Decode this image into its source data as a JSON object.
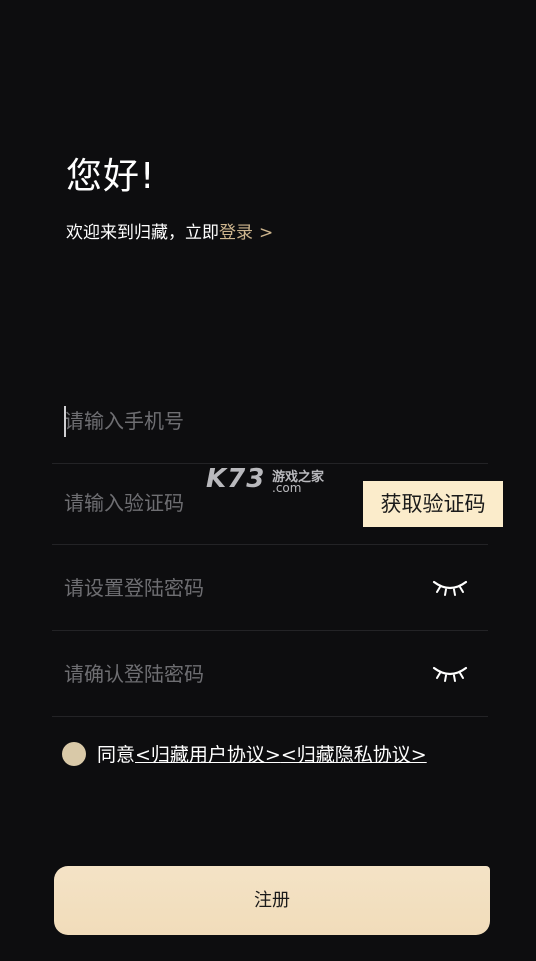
{
  "header": {
    "title": "您好!",
    "welcome_text": "欢迎来到归藏，立即",
    "login_link": "登录",
    "login_chevron": ">"
  },
  "form": {
    "phone_placeholder": "请输入手机号",
    "phone_value": "",
    "code_placeholder": "请输入验证码",
    "code_value": "",
    "get_code_label": "获取验证码",
    "password_placeholder": "请设置登陆密码",
    "password_value": "",
    "confirm_placeholder": "请确认登陆密码",
    "confirm_value": ""
  },
  "agreement": {
    "prefix": "同意",
    "user_agreement": "<归藏用户协议>",
    "privacy_agreement": "<归藏隐私协议>",
    "checked": true
  },
  "register_label": "注册",
  "watermark": {
    "brand": "K73",
    "cn": "游戏之家",
    "domain": ".com"
  },
  "icons": {
    "password_toggle": "eye-closed-icon",
    "confirm_toggle": "eye-closed-icon",
    "agree_radio": "radio-filled-icon"
  },
  "colors": {
    "background": "#0d0d0f",
    "accent_gold": "#cdb58e",
    "button_cream": "#fbeccb",
    "radio": "#d9c9a8",
    "placeholder": "#6e6e72",
    "divider": "#232326"
  }
}
